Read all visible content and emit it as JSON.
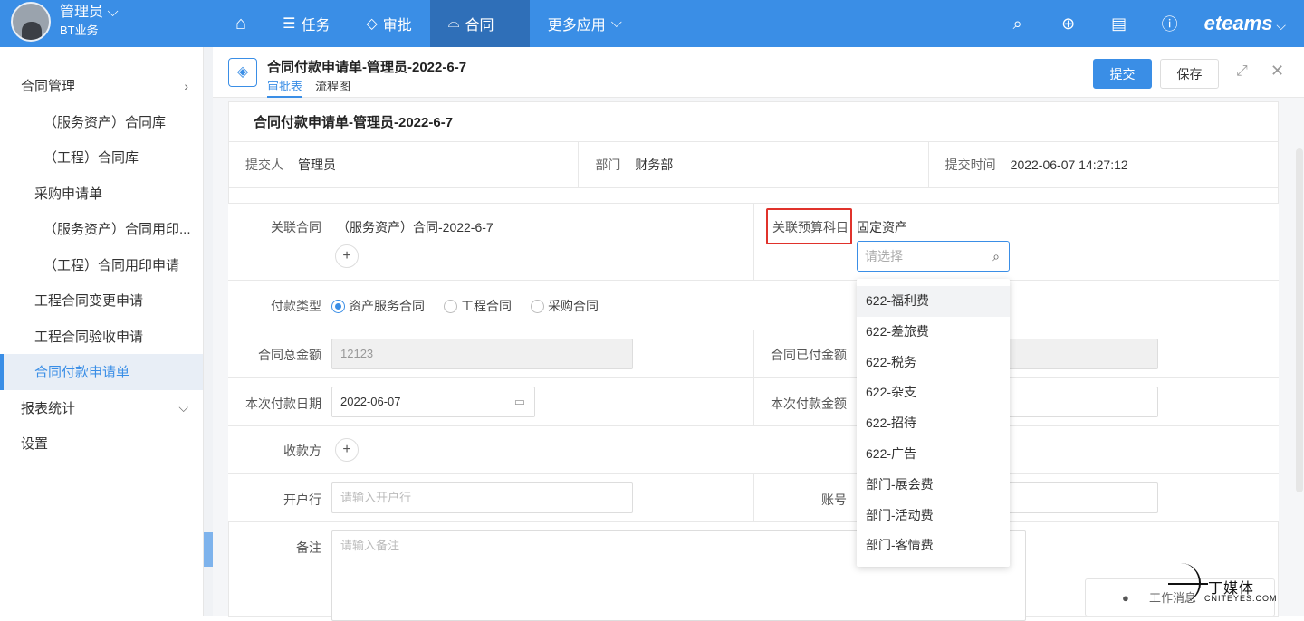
{
  "topbar": {
    "user_name": "管理员",
    "user_dept": "BT业务",
    "nav": [
      {
        "label": "任务",
        "icon": "list-icon"
      },
      {
        "label": "审批",
        "icon": "diamond-icon"
      },
      {
        "label": "合同",
        "icon": "inbox-icon"
      },
      {
        "label": "更多应用",
        "icon": "chevron-down-icon"
      }
    ],
    "brand": "eteams"
  },
  "sidebar": {
    "items": [
      {
        "label": "合同管理",
        "level": 1
      },
      {
        "label": "（服务资产）合同库",
        "level": 3
      },
      {
        "label": "（工程）合同库",
        "level": 3
      },
      {
        "label": "采购申请单",
        "level": 2
      },
      {
        "label": "（服务资产）合同用印...",
        "level": 3
      },
      {
        "label": "（工程）合同用印申请",
        "level": 3
      },
      {
        "label": "工程合同变更申请",
        "level": 2
      },
      {
        "label": "工程合同验收申请",
        "level": 2
      },
      {
        "label": "合同付款申请单",
        "level": 2,
        "active": true
      },
      {
        "label": "报表统计",
        "level": 1
      },
      {
        "label": "设置",
        "level": 1
      }
    ]
  },
  "header": {
    "title": "合同付款申请单-管理员-2022-6-7",
    "tabs": [
      "审批表",
      "流程图"
    ],
    "submit_label": "提交",
    "save_label": "保存"
  },
  "form": {
    "title": "合同付款申请单-管理员-2022-6-7",
    "info": {
      "submitter_label": "提交人",
      "submitter": "管理员",
      "dept_label": "部门",
      "dept": "财务部",
      "time_label": "提交时间",
      "time": "2022-06-07 14:27:12"
    },
    "related_contract_label": "关联合同",
    "related_contract": "（服务资产）合同-2022-6-7",
    "budget_label": "关联预算科目",
    "budget_value": "固定资产",
    "budget_search_placeholder": "请选择",
    "payment_type_label": "付款类型",
    "payment_types": [
      "资产服务合同",
      "工程合同",
      "采购合同"
    ],
    "total_amount_label": "合同总金额",
    "total_amount": "12123",
    "paid_amount_label": "合同已付金额",
    "pay_date_label": "本次付款日期",
    "pay_date": "2022-06-07",
    "pay_amount_label": "本次付款金额",
    "payee_label": "收款方",
    "bank_label": "开户行",
    "bank_placeholder": "请输入开户行",
    "account_label": "账号",
    "remark_label": "备注",
    "remark_placeholder": "请输入备注"
  },
  "dropdown": {
    "options": [
      "622-福利费",
      "622-差旅费",
      "622-税务",
      "622-杂支",
      "622-招待",
      "622-广告",
      "部门-展会费",
      "部门-活动费",
      "部门-客情费"
    ]
  },
  "message_button": "工作消息",
  "watermark": {
    "text": "丁媒体",
    "sub": "CNITEYES.COM"
  },
  "colors": {
    "primary": "#3a8ee6",
    "highlight_border": "#e0322b"
  }
}
